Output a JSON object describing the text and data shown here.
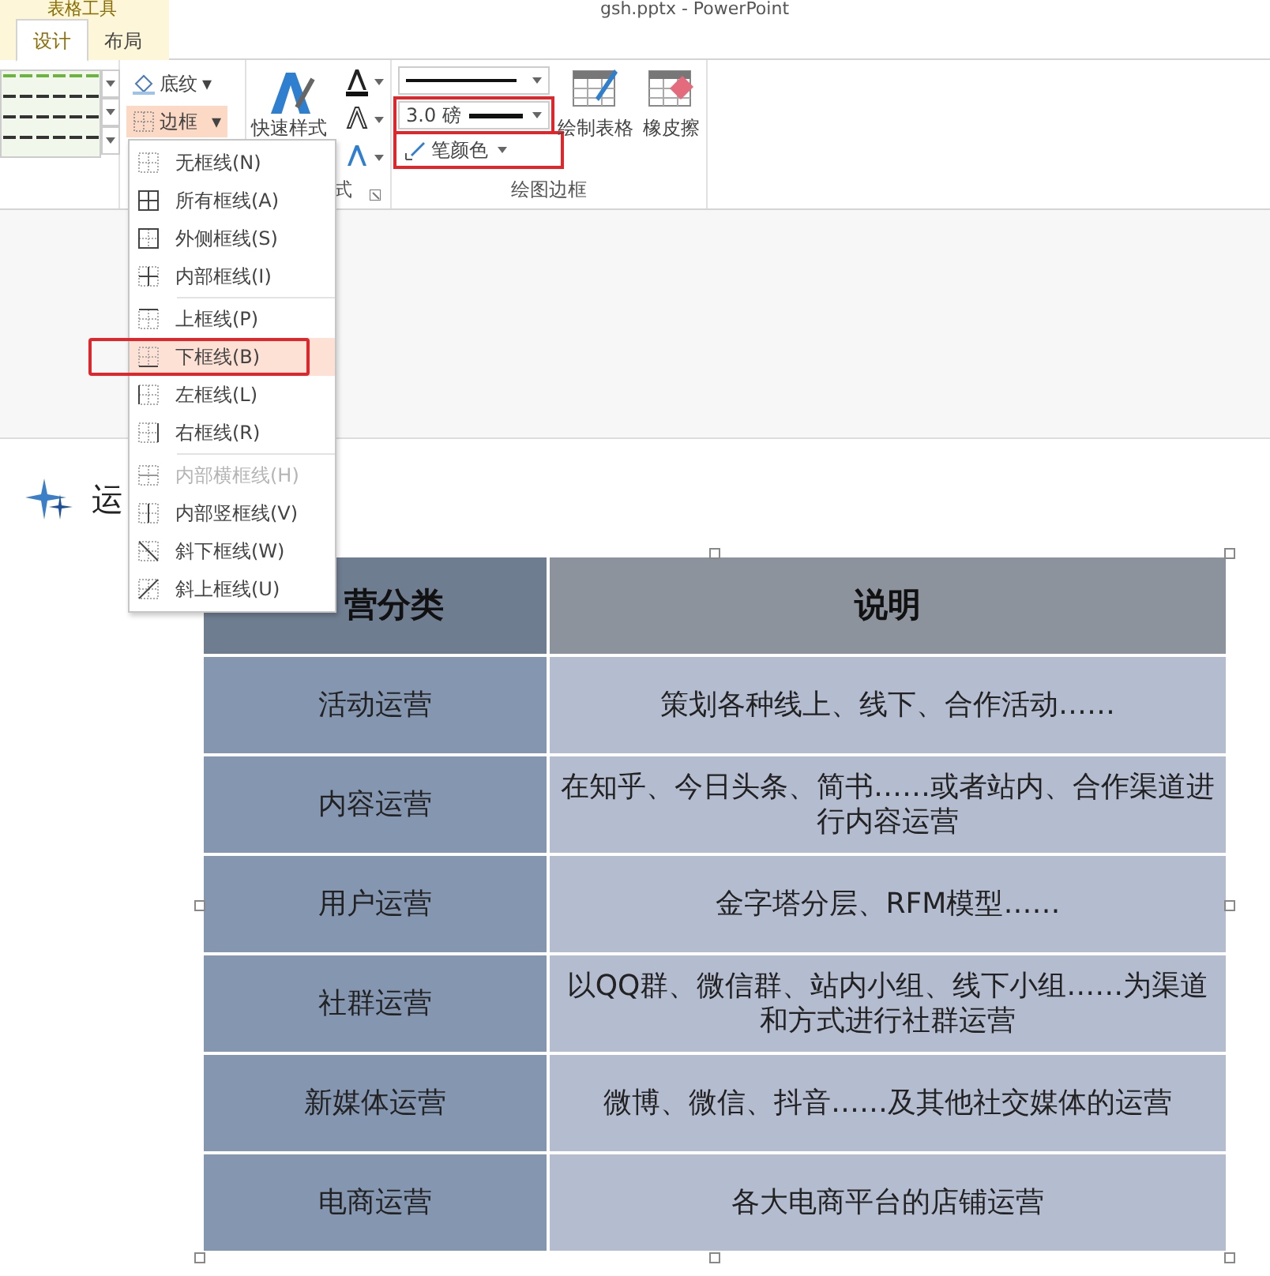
{
  "window": {
    "context_label": "表格工具",
    "title": "gsh.pptx - PowerPoint"
  },
  "tabs": [
    {
      "label": "设计",
      "selected": true
    },
    {
      "label": "布局",
      "selected": false
    }
  ],
  "ribbon": {
    "shading_button": {
      "label": "底纹",
      "caret": "▾"
    },
    "borders_button": {
      "label": "边框",
      "caret": "▾",
      "expanded": true
    },
    "quick_styles": {
      "label": "快速样式"
    },
    "style_group_label": "式",
    "pen": {
      "weight": "3.0 磅",
      "weight_highlighted": true,
      "color_label": "笔颜色",
      "color_highlighted": true
    },
    "draw_table": "绘制表格",
    "eraser": "橡皮擦",
    "group_label": "绘图边框"
  },
  "border_menu": [
    {
      "label": "无框线(N)",
      "kind": "none",
      "selected": false,
      "disabled": false,
      "highlighted": false
    },
    {
      "label": "所有框线(A)",
      "kind": "all",
      "selected": false,
      "disabled": false,
      "highlighted": false
    },
    {
      "label": "外侧框线(S)",
      "kind": "outside",
      "selected": false,
      "disabled": false,
      "highlighted": false
    },
    {
      "label": "内部框线(I)",
      "kind": "inside",
      "selected": false,
      "disabled": false,
      "highlighted": false,
      "separator_after": true
    },
    {
      "label": "上框线(P)",
      "kind": "top",
      "selected": false,
      "disabled": false,
      "highlighted": false
    },
    {
      "label": "下框线(B)",
      "kind": "bottom",
      "selected": true,
      "disabled": false,
      "highlighted": true
    },
    {
      "label": "左框线(L)",
      "kind": "left",
      "selected": false,
      "disabled": false,
      "highlighted": false
    },
    {
      "label": "右框线(R)",
      "kind": "right",
      "selected": false,
      "disabled": false,
      "highlighted": false,
      "separator_after": true
    },
    {
      "label": "内部横框线(H)",
      "kind": "inside-h",
      "selected": false,
      "disabled": true,
      "highlighted": false
    },
    {
      "label": "内部竖框线(V)",
      "kind": "inside-v",
      "selected": false,
      "disabled": false,
      "highlighted": false
    },
    {
      "label": "斜下框线(W)",
      "kind": "diag-down",
      "selected": false,
      "disabled": false,
      "highlighted": false
    },
    {
      "label": "斜上框线(U)",
      "kind": "diag-up",
      "selected": false,
      "disabled": false,
      "highlighted": false
    }
  ],
  "slide": {
    "heading": "运",
    "table": {
      "columns": [
        "营分类",
        "说明"
      ],
      "rows": [
        [
          "活动运营",
          "策划各种线上、线下、合作活动……"
        ],
        [
          "内容运营",
          "在知乎、今日头条、简书……或者站内、合作渠道进行内容运营"
        ],
        [
          "用户运营",
          "金字塔分层、RFM模型……"
        ],
        [
          "社群运营",
          "以QQ群、微信群、站内小组、线下小组……为渠道和方式进行社群运营"
        ],
        [
          "新媒体运营",
          "微博、微信、抖音……及其他社交媒体的运营"
        ],
        [
          "电商运营",
          "各大电商平台的店铺运营"
        ]
      ]
    }
  }
}
